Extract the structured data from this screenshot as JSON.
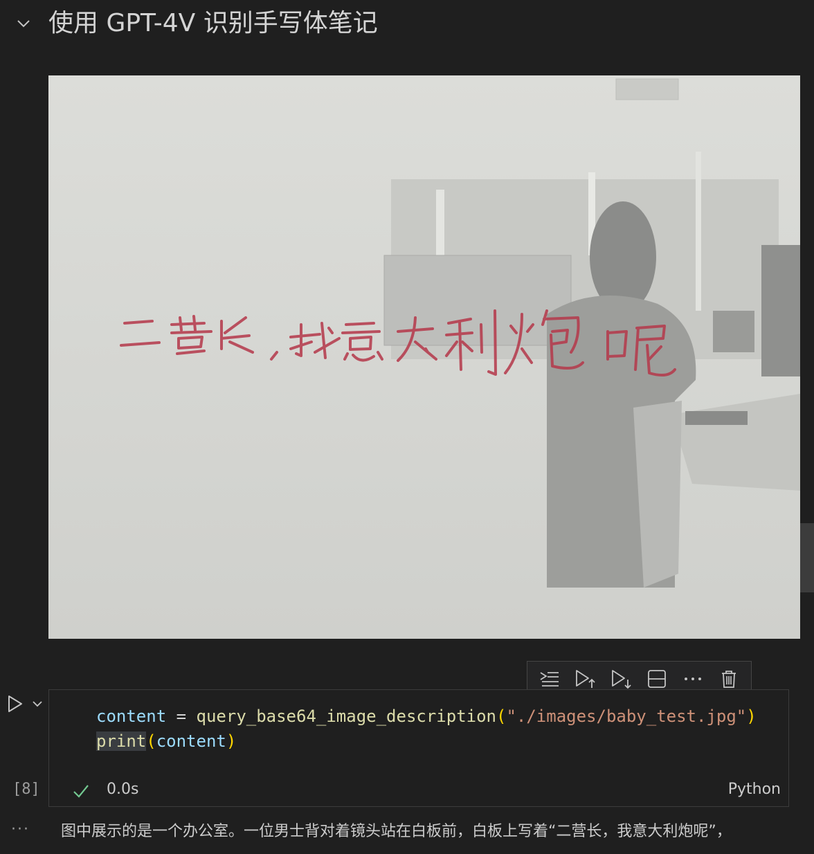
{
  "section": {
    "title": "使用 GPT-4V 识别手写体笔记"
  },
  "image": {
    "handwriting": "二营长，我意大利炮呢"
  },
  "toolbar": {
    "icons": [
      "run-by-line-icon",
      "run-above-icon",
      "run-below-icon",
      "split-cell-icon",
      "more-icon",
      "delete-icon"
    ]
  },
  "cell": {
    "code_line1": {
      "var": "content",
      "op": " = ",
      "fn": "query_base64_image_description",
      "open": "(",
      "arg": "\"./images/baby_test.jpg\"",
      "close": ")"
    },
    "code_line2": {
      "fn": "print",
      "open": "(",
      "arg": "content",
      "close": ")"
    },
    "execution_count": "[8]",
    "duration": "0.0s",
    "language": "Python"
  },
  "output": {
    "more": "···",
    "text": "图中展示的是一个办公室。一位男士背对着镜头站在白板前，白板上写着“二营长，我意大利炮呢”，"
  },
  "colors": {
    "background": "#1f1f1f",
    "success": "#73c991",
    "handwriting": "#b5384a"
  }
}
